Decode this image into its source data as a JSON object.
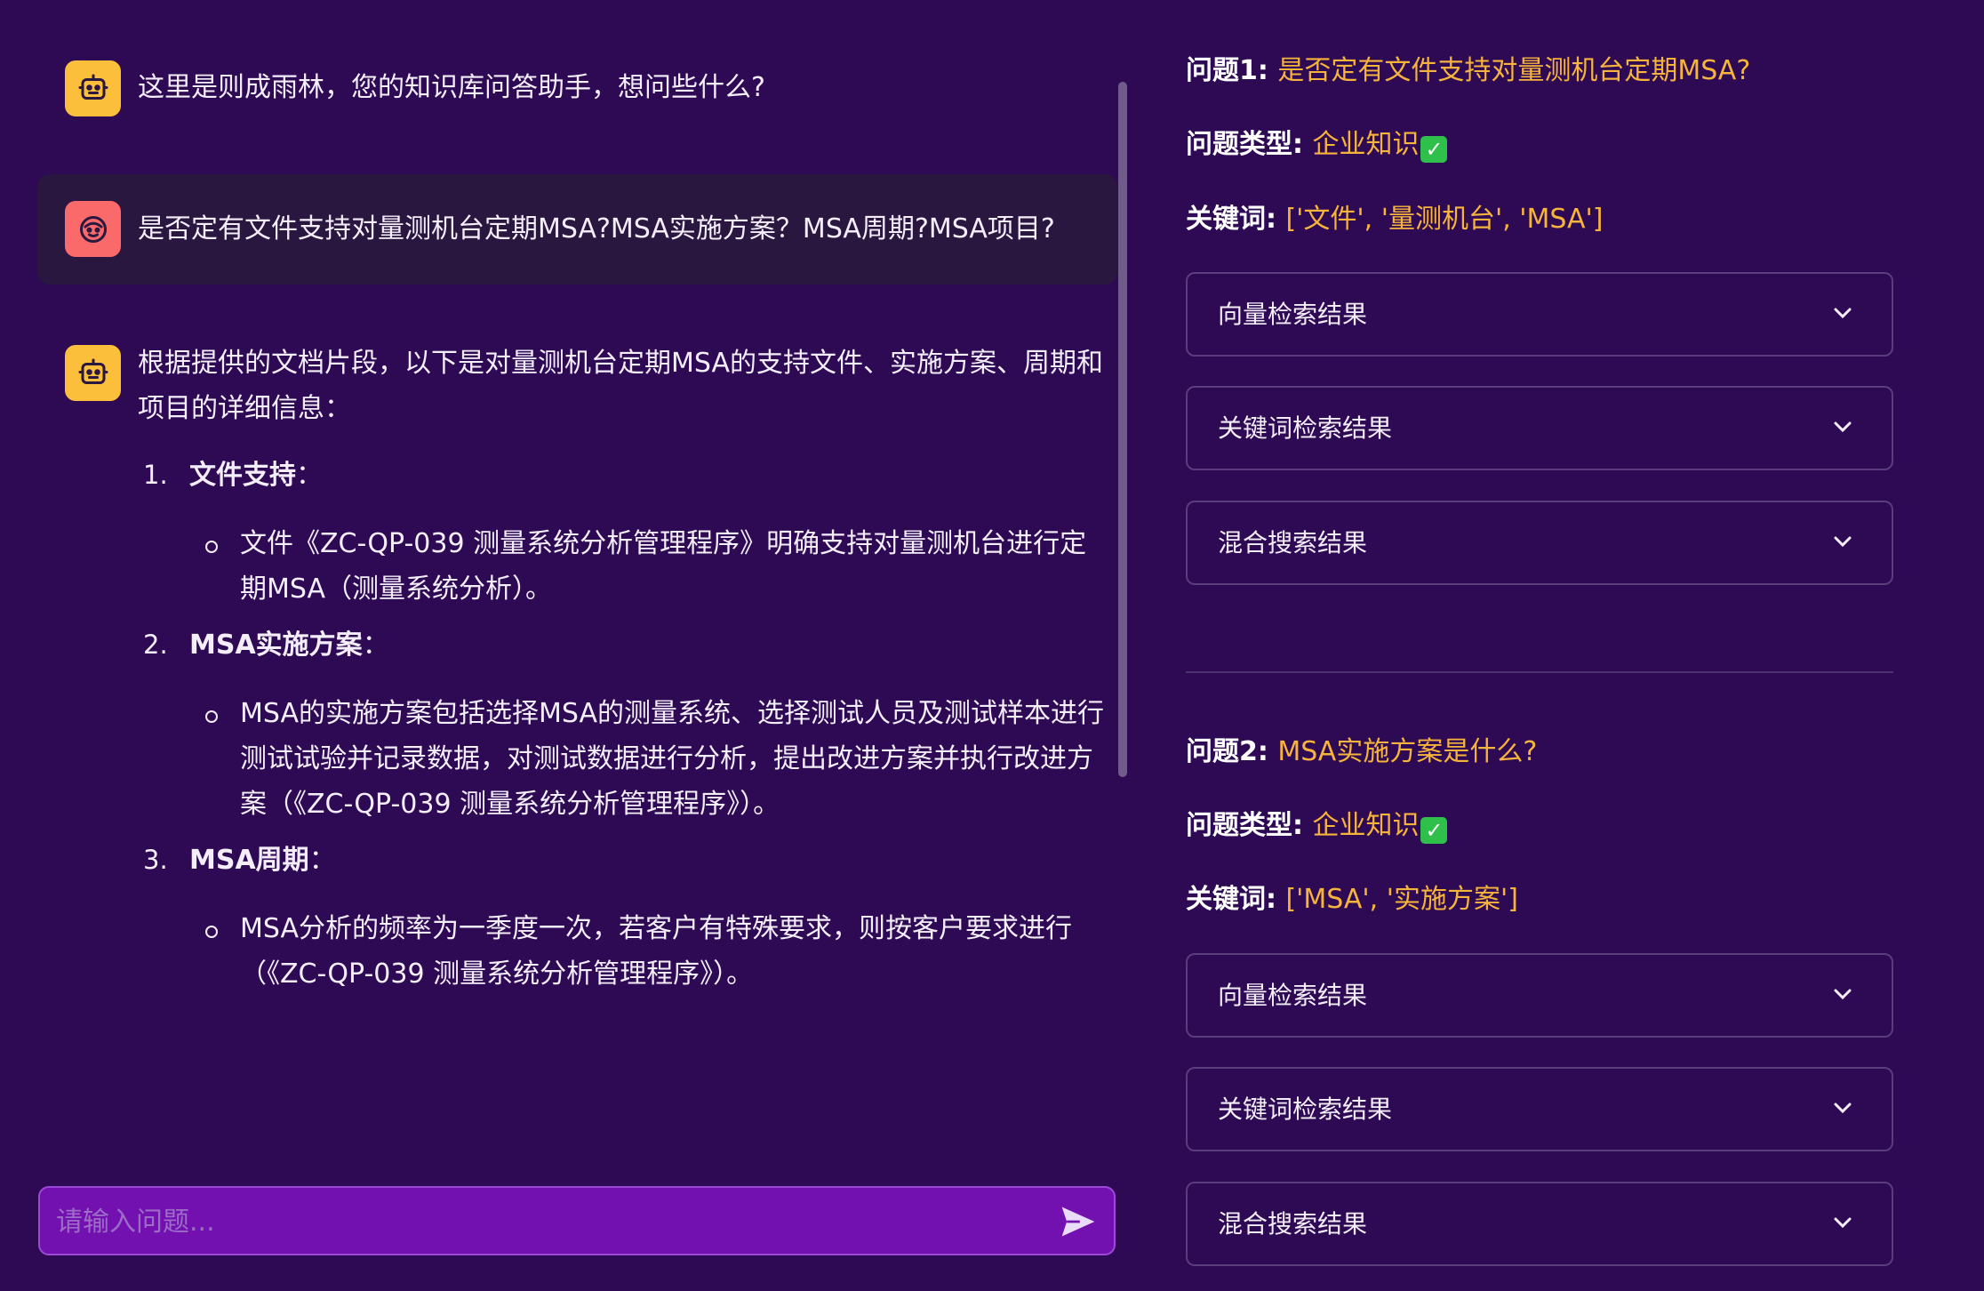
{
  "chat": {
    "greeting": "这里是则成雨林，您的知识库问答助手，想问些什么?",
    "user_question": "是否定有文件支持对量测机台定期MSA?MSA实施方案？MSA周期?MSA项目?",
    "answer_intro": "根据提供的文档片段，以下是对量测机台定期MSA的支持文件、实施方案、周期和项目的详细信息：",
    "answer_items": [
      {
        "num": "1.",
        "heading": "文件支持",
        "colon": "：",
        "bullet": "文件《ZC-QP-039 测量系统分析管理程序》明确支持对量测机台进行定期MSA（测量系统分析）。"
      },
      {
        "num": "2.",
        "heading": "MSA实施方案",
        "colon": "：",
        "bullet": "MSA的实施方案包括选择MSA的测量系统、选择测试人员及测试样本进行测试试验并记录数据，对测试数据进行分析，提出改进方案并执行改进方案（《ZC-QP-039 测量系统分析管理程序》）。"
      },
      {
        "num": "3.",
        "heading": "MSA周期",
        "colon": "：",
        "bullet": "MSA分析的频率为一季度一次，若客户有特殊要求，则按客户要求进行（《ZC-QP-039 测量系统分析管理程序》）。"
      }
    ]
  },
  "input": {
    "placeholder": "请输入问题..."
  },
  "icons": {
    "bot": "robot-icon",
    "user": "smiley-face-icon",
    "send": "paper-plane-send-icon",
    "expand": "chevron-down-icon",
    "check": "check-mark-icon"
  },
  "colors": {
    "background": "#2e0a54",
    "accent_value": "#f6b43c",
    "input_bg": "#7210b0",
    "bot_avatar": "#fbbf3c",
    "user_avatar": "#fa6a6a",
    "check": "#2ec04a"
  },
  "analysis": {
    "questions": [
      {
        "label": "问题1",
        "text": "是否定有文件支持对量测机台定期MSA?",
        "type_label": "问题类型",
        "type": "企业知识",
        "keywords_label": "关键词",
        "keywords": "['文件', '量测机台', 'MSA']",
        "expanders": [
          "向量检索结果",
          "关键词检索结果",
          "混合搜索结果"
        ]
      },
      {
        "label": "问题2",
        "text": "MSA实施方案是什么?",
        "type_label": "问题类型",
        "type": "企业知识",
        "keywords_label": "关键词",
        "keywords": "['MSA', '实施方案']",
        "expanders": [
          "向量检索结果",
          "关键词检索结果",
          "混合搜索结果"
        ]
      }
    ]
  }
}
